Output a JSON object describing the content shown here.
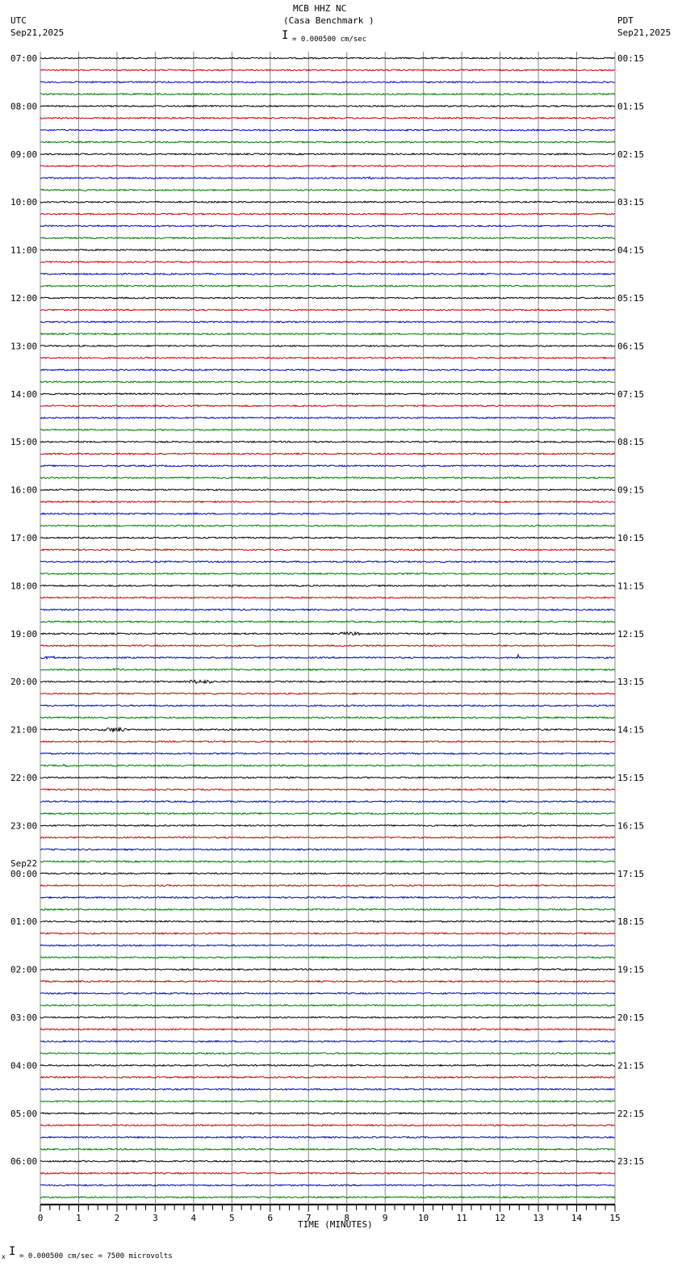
{
  "header": {
    "title": "MCB HHZ NC",
    "subtitle": "(Casa Benchmark )",
    "scale": "= 0.000500 cm/sec",
    "left_tz": "UTC",
    "left_date": "Sep21,2025",
    "right_tz": "PDT",
    "right_date": "Sep21,2025"
  },
  "footer": {
    "scale": "= 0.000500 cm/sec =    7500 microvolts",
    "prefix": "x"
  },
  "chart_data": {
    "type": "line",
    "title": "MCB HHZ NC (Casa Benchmark )",
    "xlabel": "TIME (MINUTES)",
    "xlim": [
      0,
      15
    ],
    "x_ticks": [
      "0",
      "1",
      "2",
      "3",
      "4",
      "5",
      "6",
      "7",
      "8",
      "9",
      "10",
      "11",
      "12",
      "13",
      "14",
      "15"
    ],
    "traces_per_hour": 4,
    "trace_colors": [
      "#000000",
      "#cc0000",
      "#0000cc",
      "#007700"
    ],
    "left_labels": [
      "07:00",
      "08:00",
      "09:00",
      "10:00",
      "11:00",
      "12:00",
      "13:00",
      "14:00",
      "15:00",
      "16:00",
      "17:00",
      "18:00",
      "19:00",
      "20:00",
      "21:00",
      "22:00",
      "23:00",
      "00:00",
      "01:00",
      "02:00",
      "03:00",
      "04:00",
      "05:00",
      "06:00"
    ],
    "date_change_label": "Sep22",
    "date_change_index": 17,
    "right_labels": [
      "00:15",
      "01:15",
      "02:15",
      "03:15",
      "04:15",
      "05:15",
      "06:15",
      "07:15",
      "08:15",
      "09:15",
      "10:15",
      "11:15",
      "12:15",
      "13:15",
      "14:15",
      "15:15",
      "16:15",
      "17:15",
      "18:15",
      "19:15",
      "20:15",
      "21:15",
      "22:15",
      "23:15"
    ],
    "events": [
      {
        "trace": 10,
        "start_min": 8.3,
        "end_min": 9.6,
        "amplitude": 1.6
      },
      {
        "trace": 48,
        "start_min": 7.7,
        "end_min": 9.6,
        "amplitude": 2.2
      },
      {
        "trace": 50,
        "start_min": 0.0,
        "end_min": 1.3,
        "amplitude": 2.0
      },
      {
        "trace": 50,
        "start_min": 12.45,
        "end_min": 12.6,
        "amplitude": 9
      },
      {
        "trace": 51,
        "start_min": 1.8,
        "end_min": 2.8,
        "amplitude": 1.6
      },
      {
        "trace": 52,
        "start_min": 3.7,
        "end_min": 6.0,
        "amplitude": 2.5
      },
      {
        "trace": 56,
        "start_min": 1.6,
        "end_min": 3.3,
        "amplitude": 3.2
      },
      {
        "trace": 59,
        "start_min": 0.3,
        "end_min": 2.0,
        "amplitude": 1.6
      }
    ]
  }
}
